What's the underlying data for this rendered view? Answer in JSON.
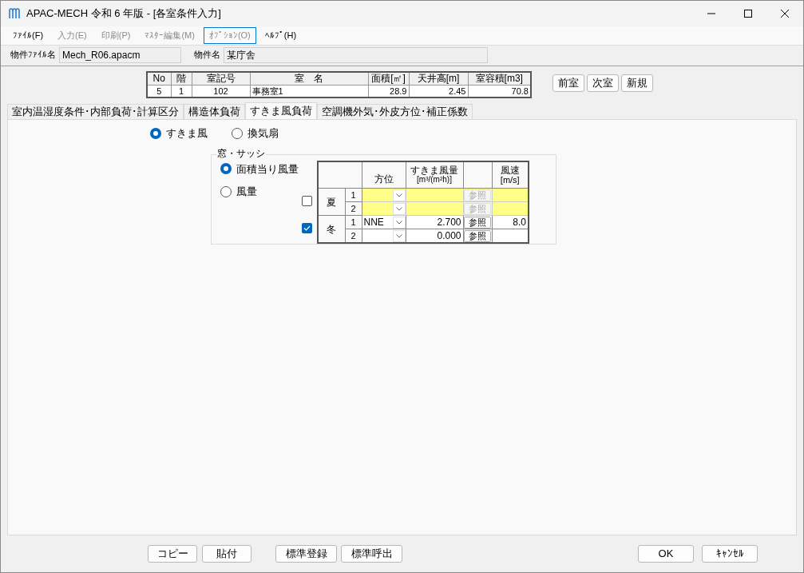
{
  "window": {
    "title": "APAC-MECH 令和 6 年版 - [各室条件入力]"
  },
  "menu": [
    {
      "label": "ﾌｧｲﾙ(F)",
      "disabled": false,
      "selected": false
    },
    {
      "label": "入力(E)",
      "disabled": true,
      "selected": false
    },
    {
      "label": "印刷(P)",
      "disabled": true,
      "selected": false
    },
    {
      "label": "ﾏｽﾀｰ編集(M)",
      "disabled": true,
      "selected": false
    },
    {
      "label": "ｵﾌﾟｼｮﾝ(O)",
      "disabled": true,
      "selected": true
    },
    {
      "label": "ﾍﾙﾌﾟ(H)",
      "disabled": false,
      "selected": false
    }
  ],
  "file_info": [
    {
      "label": "物件ﾌｧｲﾙ名",
      "value": "Mech_R06.apacm"
    },
    {
      "label": "物件名",
      "value": "某庁舎"
    }
  ],
  "room_table": {
    "columns": [
      "No",
      "階",
      "室記号",
      "室　名",
      "面積[㎡]",
      "天井高[m]",
      "室容積[m3]"
    ],
    "row": [
      "5",
      "1",
      "102",
      "事務室1",
      "28.9",
      "2.45",
      "70.8"
    ]
  },
  "nav_buttons": [
    "前室",
    "次室",
    "新規"
  ],
  "tabs": [
    {
      "label": "室内温湿度条件･内部負荷･計算区分",
      "selected": false
    },
    {
      "label": "構造体負荷",
      "selected": false
    },
    {
      "label": "すきま風負荷",
      "selected": true
    },
    {
      "label": "空調機外気･外皮方位･補正係数",
      "selected": false
    }
  ],
  "mode_radios": [
    {
      "label": "すきま風",
      "selected": true
    },
    {
      "label": "換気扇",
      "selected": false
    }
  ],
  "window_group": {
    "title": "窓・サッシ",
    "radios": [
      {
        "label": "面積当り風量",
        "selected": true
      },
      {
        "label": "風量",
        "selected": false
      }
    ],
    "columns": [
      "方位",
      "すきま風量",
      "[m³/(m²h)]",
      "風速",
      "[m/s]"
    ],
    "seasons": [
      {
        "label": "夏",
        "checked": false,
        "rows": [
          {
            "no": "1",
            "button": "参照"
          },
          {
            "no": "2",
            "button": "参照"
          }
        ]
      },
      {
        "label": "冬",
        "checked": true,
        "rows": [
          {
            "no": "1",
            "direction": "NNE",
            "rate": "2.700",
            "button": "参照",
            "speed": "8.0"
          },
          {
            "no": "2",
            "rate": "0.000",
            "button": "参照"
          }
        ]
      }
    ]
  },
  "bottom_left": [
    "コピー",
    "貼付"
  ],
  "bottom_mid": [
    "標準登録",
    "標準呼出"
  ],
  "bottom_right": [
    "OK",
    "ｷｬﾝｾﾙ"
  ]
}
